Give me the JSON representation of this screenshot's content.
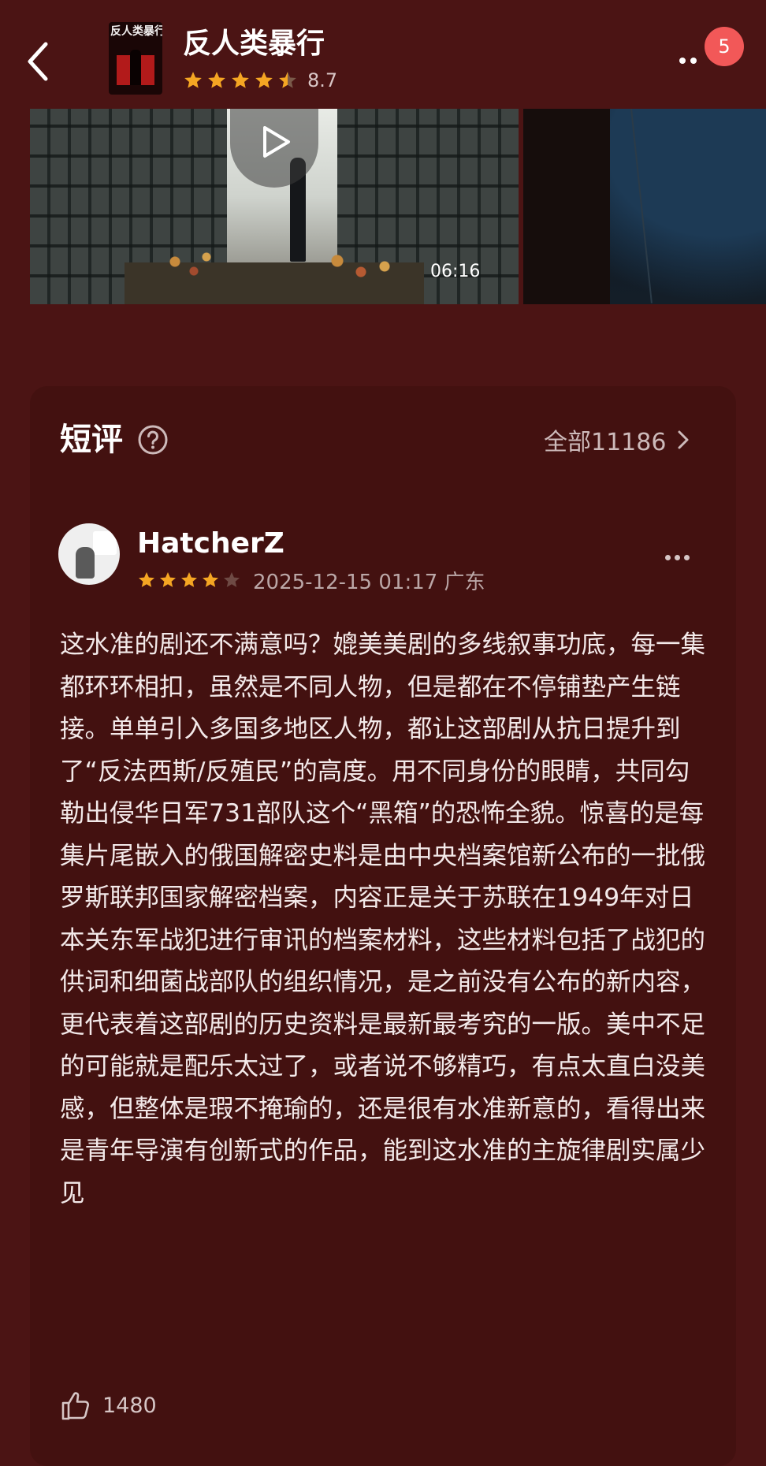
{
  "header": {
    "poster_text": "反人类暴行",
    "title": "反人类暴行",
    "rating": "8.7",
    "badge_count": "5"
  },
  "video": {
    "duration": "06:16"
  },
  "comments": {
    "section_title": "短评",
    "all_label": "全部11186",
    "items": [
      {
        "username": "HatcherZ",
        "stars": 4,
        "meta": "2025-12-15 01:17 广东",
        "text": "这水准的剧还不满意吗？媲美美剧的多线叙事功底，每一集都环环相扣，虽然是不同人物，但是都在不停铺垫产生链接。单单引入多国多地区人物，都让这部剧从抗日提升到了“反法西斯/反殖民”的高度。用不同身份的眼睛，共同勾勒出侵华日军731部队这个“黑箱”的恐怖全貌。惊喜的是每集片尾嵌入的俄国解密史料是由中央档案馆新公布的一批俄罗斯联邦国家解密档案，内容正是关于苏联在1949年对日本关东军战犯进行审讯的档案材料，这些材料包括了战犯的供词和细菌战部队的组织情况，是之前没有公布的新内容，更代表着这部剧的历史资料是最新最考究的一版。美中不足的可能就是配乐太过了，或者说不够精巧，有点太直白没美感，但整体是瑕不掩瑜的，还是很有水准新意的，看得出来是青年导演有创新式的作品，能到这水准的主旋律剧实属少见",
        "likes": "1480"
      }
    ]
  },
  "colors": {
    "background": "#4b1414",
    "card": "#431110",
    "star": "#f5a623",
    "badge": "#f25858"
  }
}
